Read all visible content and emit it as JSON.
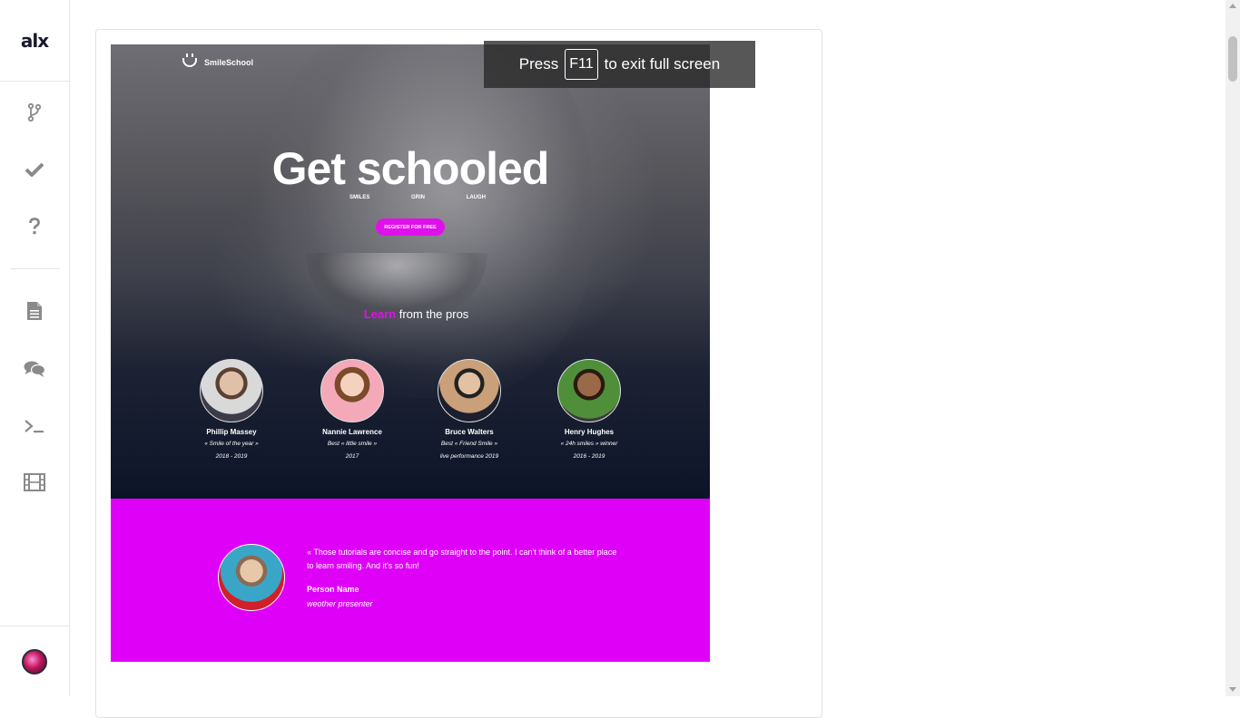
{
  "sidebar": {
    "logo_text": "alx",
    "items": [
      {
        "icon": "branch-icon"
      },
      {
        "icon": "checkmark-icon"
      },
      {
        "icon": "question-icon"
      },
      {
        "icon": "document-icon"
      },
      {
        "icon": "chat-icon"
      },
      {
        "icon": "terminal-icon"
      },
      {
        "icon": "film-icon"
      }
    ],
    "avatar_icon": "user-avatar"
  },
  "fullscreen_notice": {
    "before": "Press",
    "key": "F11",
    "after": "to exit full screen"
  },
  "preview": {
    "brand": "SmileSchool",
    "title": "Get schooled",
    "subtitles": [
      "SMILES",
      "GRIN",
      "LAUGH"
    ],
    "cta": "REGISTER FOR FREE",
    "learn_accent": "Learn",
    "learn_rest": "from the pros",
    "pros": [
      {
        "name": "Phillip Massey",
        "line1": "« Smile of the year »",
        "line2": "2018 - 2019"
      },
      {
        "name": "Nannie Lawrence",
        "line1": "Best « little smile »",
        "line2": "2017"
      },
      {
        "name": "Bruce Walters",
        "line1": "Best « Friend Smile »",
        "line2": "live performance 2019"
      },
      {
        "name": "Henry Hughes",
        "line1": "« 24h smiles » winner",
        "line2": "2016 - 2019"
      }
    ],
    "quote": {
      "text": "« Those tutorials are concise and go straight to the point. I can't think of a better place to learn smiling. And it's so fun!",
      "name": "Person Name",
      "role": "weother presenter"
    }
  },
  "colors": {
    "accent": "#df00f8",
    "hero_dark": "#0c1428",
    "sidebar_icon": "#8a8a8a"
  }
}
